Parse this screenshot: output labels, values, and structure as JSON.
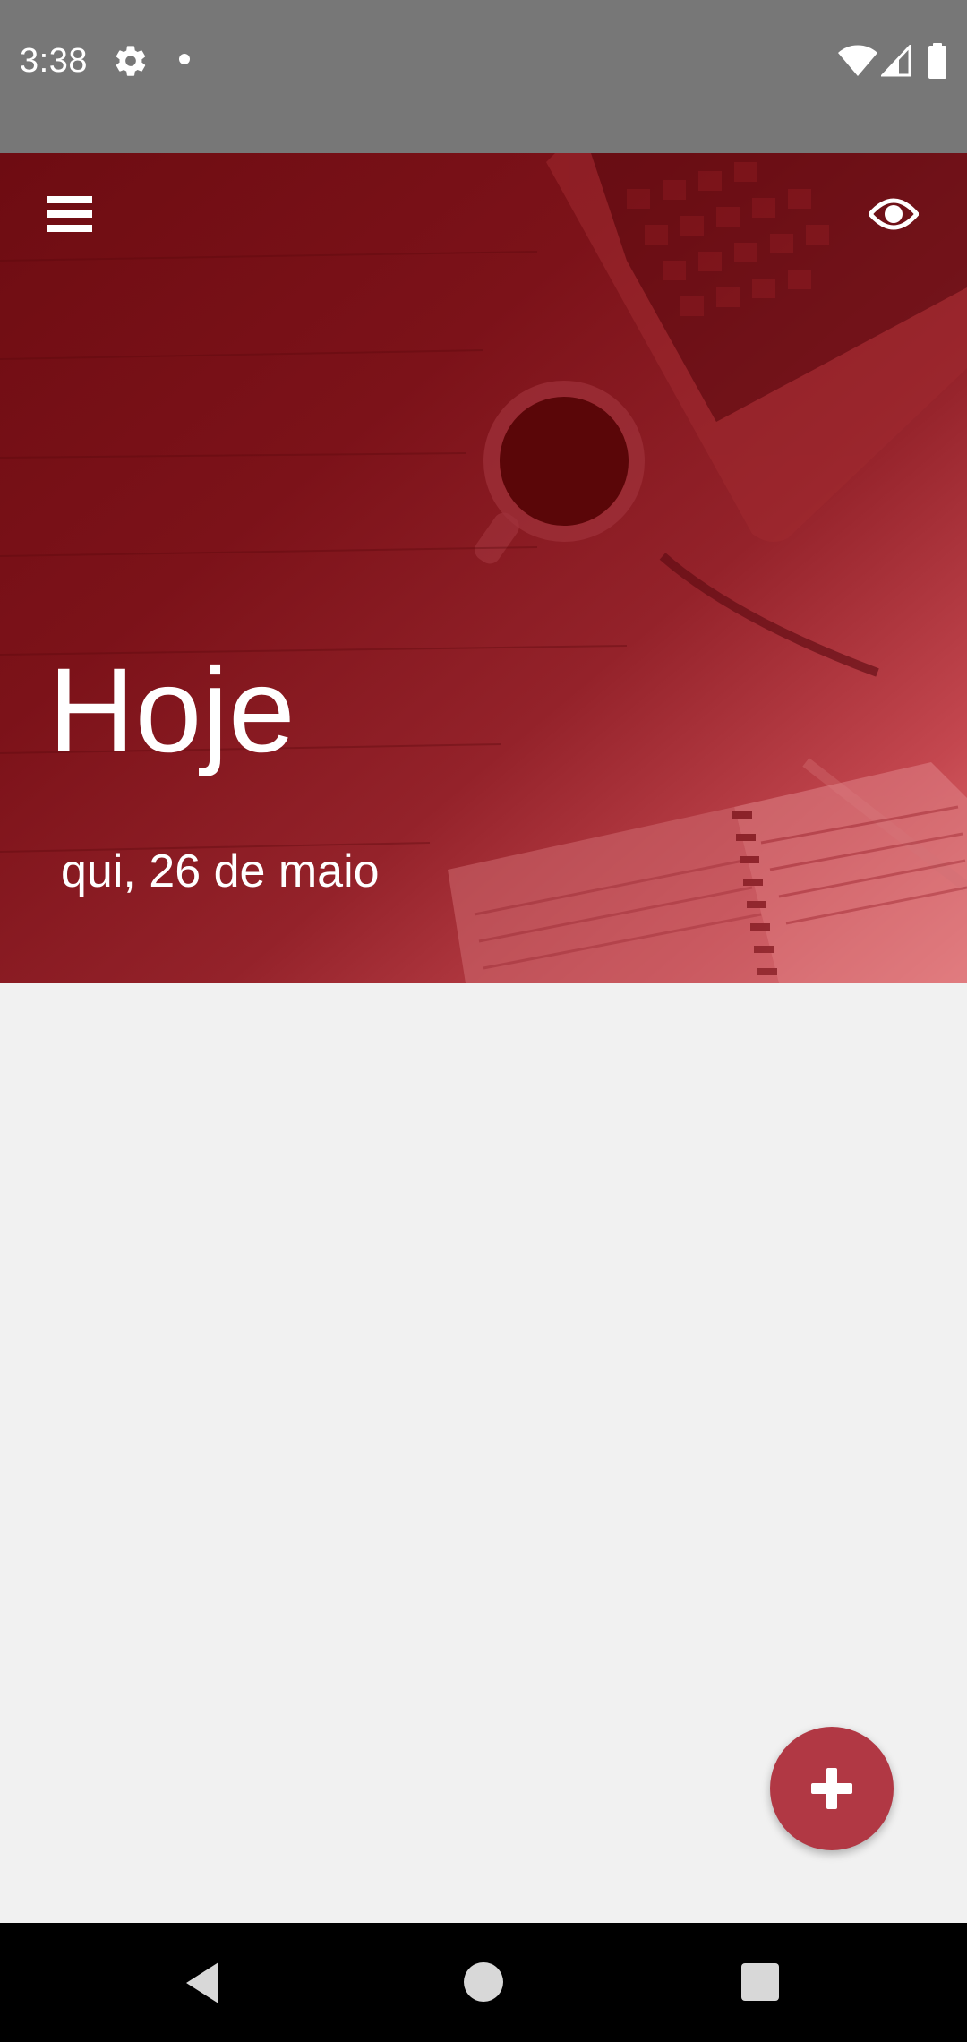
{
  "status_bar": {
    "time": "3:38",
    "icons": [
      "settings-gear-icon",
      "notification-dot-icon",
      "wifi-icon",
      "cell-signal-icon",
      "battery-icon"
    ]
  },
  "header": {
    "menu_icon": "hamburger-menu-icon",
    "visibility_icon": "eye-icon",
    "title": "Hoje",
    "date": "qui, 26 de maio",
    "overlay_color": "#8b1a22"
  },
  "fab": {
    "icon": "plus-icon",
    "color": "#b13844"
  },
  "nav_bar": {
    "icons": [
      "back-triangle-icon",
      "home-circle-icon",
      "recents-square-icon"
    ]
  }
}
